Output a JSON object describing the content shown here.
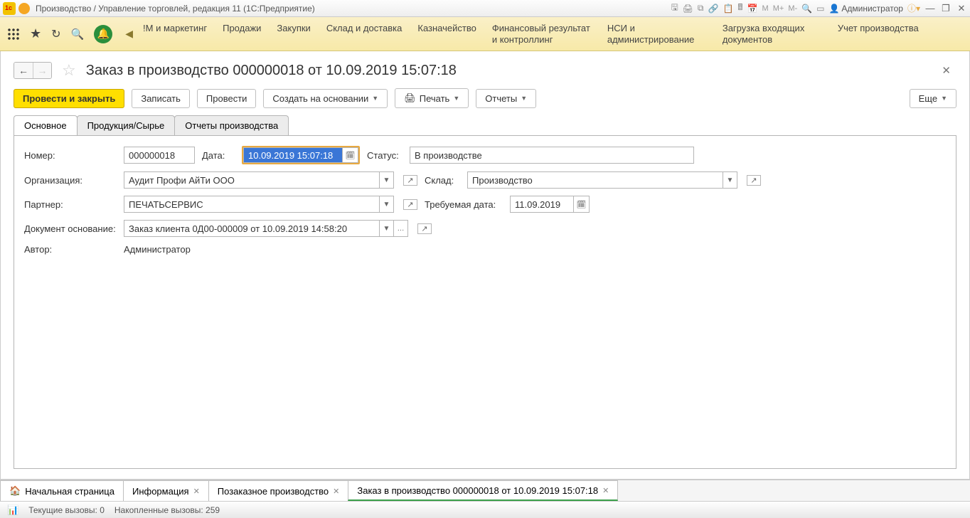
{
  "window": {
    "title": "Производство / Управление торговлей, редакция 11  (1С:Предприятие)",
    "user": "Администратор"
  },
  "toolbar_letters": {
    "m1": "M",
    "m2": "M+",
    "m3": "M-"
  },
  "menu": {
    "items": [
      "!М и маркетинг",
      "Продажи",
      "Закупки",
      "Склад и доставка",
      "Казначейство",
      "Финансовый результат и контроллинг",
      "НСИ и администрирование",
      "Загрузка входящих документов",
      "Учет производства"
    ]
  },
  "page": {
    "title": "Заказ в производство 000000018 от 10.09.2019 15:07:18",
    "buttons": {
      "post_close": "Провести и закрыть",
      "save": "Записать",
      "post": "Провести",
      "create_based": "Создать на основании",
      "print": "Печать",
      "reports": "Отчеты",
      "more": "Еще"
    },
    "tabs": [
      "Основное",
      "Продукция/Сырье",
      "Отчеты производства"
    ]
  },
  "form": {
    "number_label": "Номер:",
    "number_value": "000000018",
    "date_label": "Дата:",
    "date_value": "10.09.2019 15:07:18",
    "status_label": "Статус:",
    "status_value": "В производстве",
    "org_label": "Организация:",
    "org_value": "Аудит Профи АйТи ООО",
    "warehouse_label": "Склад:",
    "warehouse_value": "Производство",
    "partner_label": "Партнер:",
    "partner_value": "ПЕЧАТЬСЕРВИС",
    "reqdate_label": "Требуемая дата:",
    "reqdate_value": "11.09.2019",
    "basis_label": "Документ основание:",
    "basis_value": "Заказ клиента 0Д00-000009 от 10.09.2019 14:58:20",
    "author_label": "Автор:",
    "author_value": "Администратор"
  },
  "bottom_tabs": [
    {
      "label": "Начальная страница",
      "home": true,
      "closable": false
    },
    {
      "label": "Информация",
      "closable": true
    },
    {
      "label": "Позаказное производство",
      "closable": true
    },
    {
      "label": "Заказ в производство 000000018 от 10.09.2019 15:07:18",
      "closable": true,
      "active": true
    }
  ],
  "status_bar": {
    "current": "Текущие вызовы: 0",
    "accum": "Накопленные вызовы: 259"
  }
}
